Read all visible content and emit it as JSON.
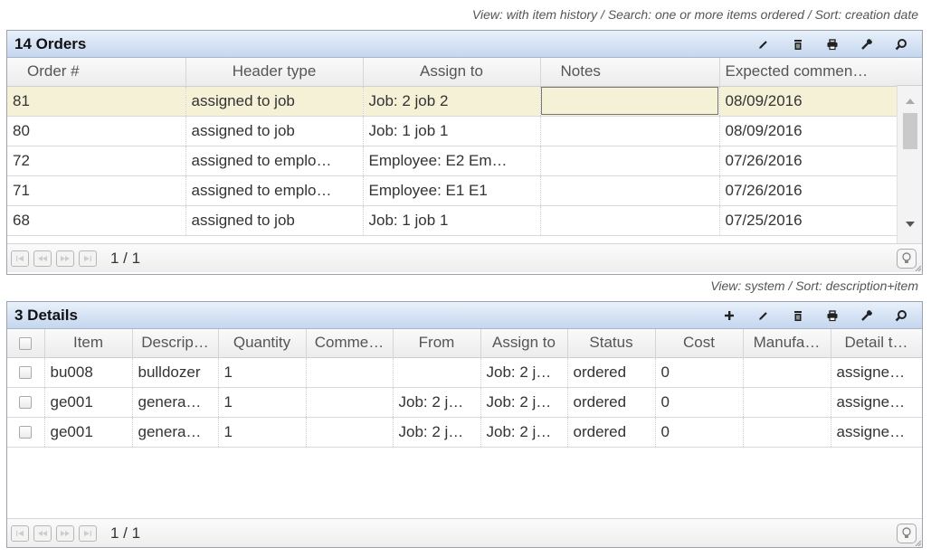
{
  "orders_panel": {
    "caption": "View: with item history / Search: one or more items ordered / Sort: creation date",
    "title": "14 Orders",
    "columns": [
      "Order #",
      "Header type",
      "Assign to",
      "Notes",
      "Expected commen…"
    ],
    "rows": [
      [
        "81",
        "assigned to job",
        "Job: 2 job 2",
        "",
        "08/09/2016"
      ],
      [
        "80",
        "assigned to job",
        "Job: 1 job 1",
        "",
        "08/09/2016"
      ],
      [
        "72",
        "assigned to emplo…",
        "Employee: E2 Em…",
        "",
        "07/26/2016"
      ],
      [
        "71",
        "assigned to emplo…",
        "Employee: E1 E1",
        "",
        "07/26/2016"
      ],
      [
        "68",
        "assigned to job",
        "Job: 1 job 1",
        "",
        "07/25/2016"
      ]
    ],
    "page_info": "1 / 1",
    "tools": [
      "edit-icon",
      "delete-icon",
      "print-icon",
      "settings-icon",
      "search-icon"
    ]
  },
  "details_panel": {
    "caption": "View: system / Sort: description+item",
    "title": "3 Details",
    "columns": [
      "Item",
      "Descrip…",
      "Quantity",
      "Comme…",
      "From",
      "Assign to",
      "Status",
      "Cost",
      "Manufa…",
      "Detail t…"
    ],
    "rows": [
      [
        "bu008",
        "bulldozer",
        "1",
        "",
        "",
        "Job: 2 j…",
        "ordered",
        "0",
        "",
        "assigne…"
      ],
      [
        "ge001",
        "genera…",
        "1",
        "",
        "Job: 2 j…",
        "Job: 2 j…",
        "ordered",
        "0",
        "",
        "assigne…"
      ],
      [
        "ge001",
        "genera…",
        "1",
        "",
        "Job: 2 j…",
        "Job: 2 j…",
        "ordered",
        "0",
        "",
        "assigne…"
      ]
    ],
    "page_info": "1 / 1",
    "tools": [
      "add-icon",
      "edit-icon",
      "delete-icon",
      "print-icon",
      "settings-icon",
      "search-icon"
    ]
  }
}
